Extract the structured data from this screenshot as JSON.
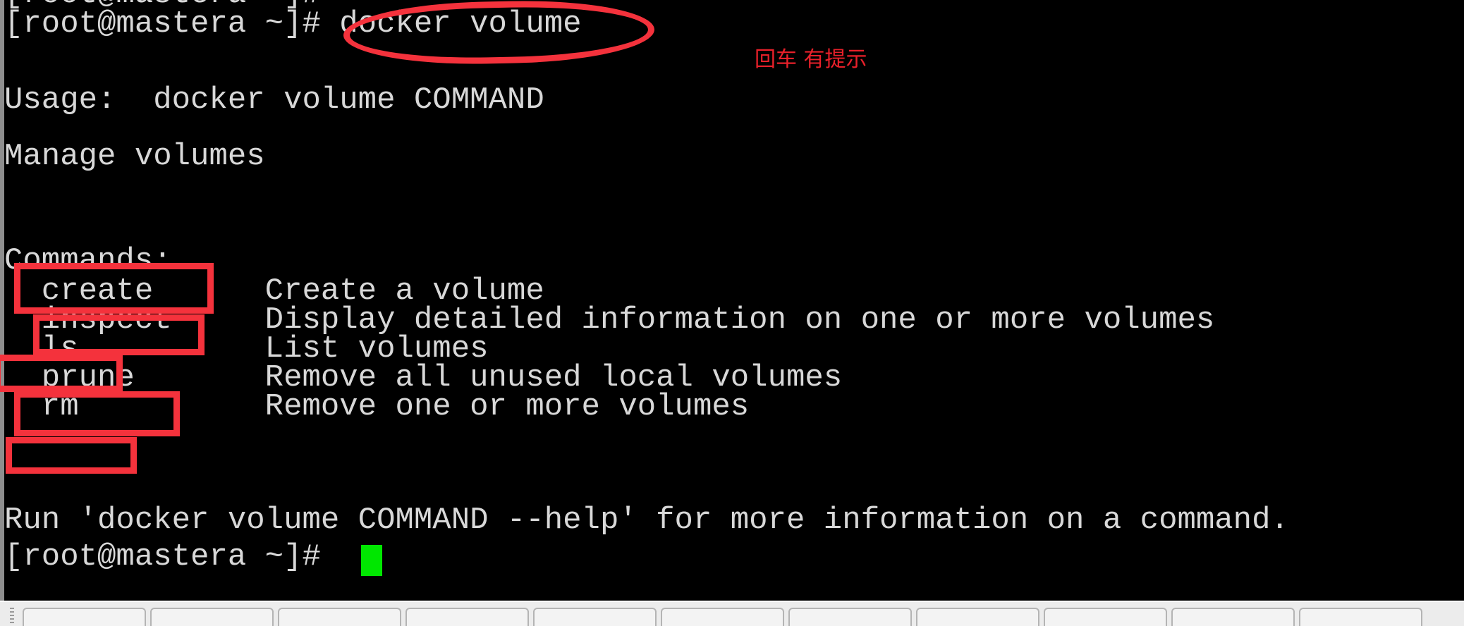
{
  "terminal": {
    "prompt": "[root@mastera ~]#",
    "scrollback_top_line": "[root@mastera ~]#",
    "command_line": "[root@mastera ~]# docker volume",
    "usage_label": "Usage:  docker volume COMMAND",
    "description": "Manage volumes",
    "commands_header": "Commands:",
    "commands": [
      {
        "name": "create",
        "desc": "Create a volume"
      },
      {
        "name": "inspect",
        "desc": "Display detailed information on one or more volumes"
      },
      {
        "name": "ls",
        "desc": "List volumes"
      },
      {
        "name": "prune",
        "desc": "Remove all unused local volumes"
      },
      {
        "name": "rm",
        "desc": "Remove one or more volumes"
      }
    ],
    "command_rows": [
      "  create      Create a volume",
      "  inspect     Display detailed information on one or more volumes",
      "  ls          List volumes",
      "  prune       Remove all unused local volumes",
      "  rm          Remove one or more volumes"
    ],
    "footer_hint": "Run 'docker volume COMMAND --help' for more information on a command.",
    "final_prompt": "[root@mastera ~]# ",
    "cursor": "block-cursor",
    "colors": {
      "background": "#000000",
      "foreground": "#d8d8d8",
      "cursor": "#00e700"
    }
  },
  "annotations": {
    "highlight_color": "#f4323c",
    "note_color": "#e8202a",
    "note_text": "回车 有提示",
    "ellipse_target": "docker volume",
    "boxed_commands": [
      "create",
      "inspect",
      "ls",
      "prune",
      "rm"
    ]
  },
  "taskbar": {
    "button_count": 11
  }
}
